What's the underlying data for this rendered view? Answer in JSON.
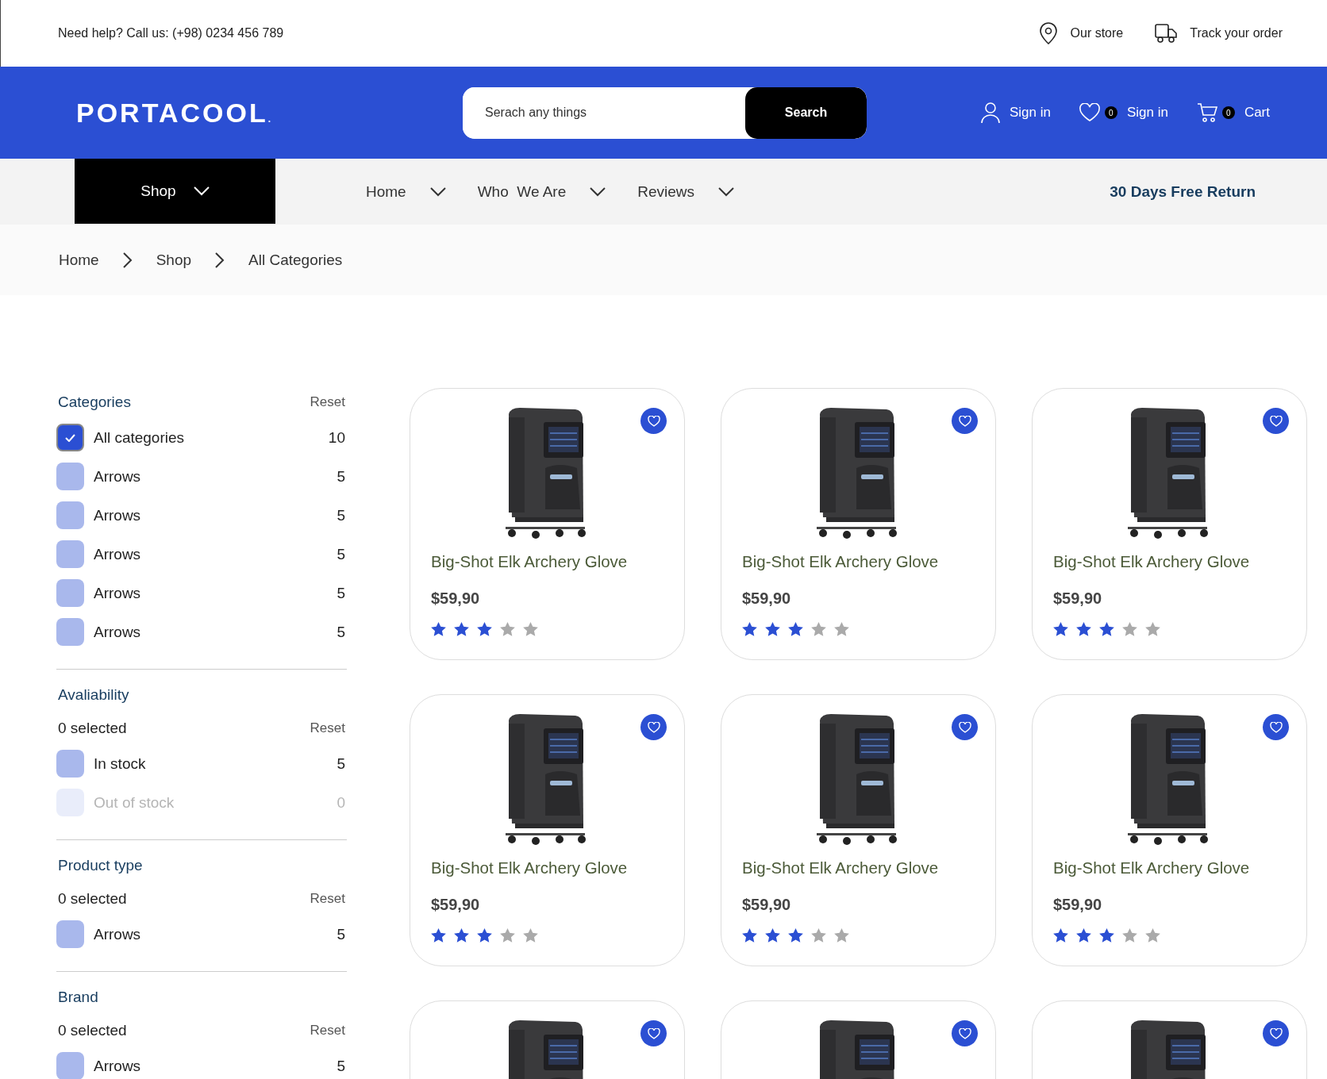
{
  "top_bar": {
    "help": "Need help? Call us: (+98) 0234 456 789",
    "links": [
      {
        "label": "Our store"
      },
      {
        "label": "Track your order"
      }
    ]
  },
  "header": {
    "logo": "PORTACOOL",
    "logo_mark": ".",
    "search": {
      "placeholder": "Serach any things",
      "button": "Search"
    },
    "actions": [
      {
        "label": "Sign in"
      },
      {
        "count": "0",
        "label": "Sign in"
      },
      {
        "count": "0",
        "label": "Cart"
      }
    ]
  },
  "nav": {
    "shop": "Shop",
    "items": [
      "Home",
      "Who  We Are",
      "Reviews"
    ],
    "promo": "30 Days Free Return"
  },
  "breadcrumb": [
    "Home",
    "Shop",
    "All Categories"
  ],
  "filters": [
    {
      "title": "Categories",
      "reset": "Reset",
      "options": [
        {
          "label": "All categories",
          "count": "10",
          "checked": true,
          "disabled": false
        },
        {
          "label": "Arrows",
          "count": "5",
          "checked": false,
          "disabled": false
        },
        {
          "label": "Arrows",
          "count": "5",
          "checked": false,
          "disabled": false
        },
        {
          "label": "Arrows",
          "count": "5",
          "checked": false,
          "disabled": false
        },
        {
          "label": "Arrows",
          "count": "5",
          "checked": false,
          "disabled": false
        },
        {
          "label": "Arrows",
          "count": "5",
          "checked": false,
          "disabled": false
        }
      ]
    },
    {
      "title": "Avaliability",
      "summary": "0 selected",
      "reset": "Reset",
      "options": [
        {
          "label": "In stock",
          "count": "5",
          "checked": false,
          "disabled": false
        },
        {
          "label": "Out of stock",
          "count": "0",
          "checked": false,
          "disabled": true
        }
      ]
    },
    {
      "title": "Product type",
      "summary": "0 selected",
      "reset": "Reset",
      "options": [
        {
          "label": "Arrows",
          "count": "5",
          "checked": false,
          "disabled": false
        }
      ]
    },
    {
      "title": "Brand",
      "summary": "0 selected",
      "reset": "Reset",
      "options": [
        {
          "label": "Arrows",
          "count": "5",
          "checked": false,
          "disabled": false
        }
      ]
    }
  ],
  "products": [
    {
      "kind": "product",
      "title": "Big-Shot Elk Archery Glove",
      "price": "$59,90",
      "stars": 3
    },
    {
      "kind": "product",
      "title": "Big-Shot Elk Archery Glove",
      "price": "$59,90",
      "stars": 3
    },
    {
      "kind": "product",
      "title": "Big-Shot Elk Archery Glove",
      "price": "$59,90",
      "stars": 3
    },
    {
      "kind": "product",
      "title": "Big-Shot Elk Archery Glove",
      "price": "$59,90",
      "stars": 3
    },
    {
      "kind": "product",
      "title": "Big-Shot Elk Archery Glove",
      "price": "$59,90",
      "stars": 3
    },
    {
      "kind": "product",
      "title": "Big-Shot Elk Archery Glove",
      "price": "$59,90",
      "stars": 3
    },
    {
      "kind": "picture"
    },
    {
      "kind": "picture"
    },
    {
      "kind": "picture"
    }
  ]
}
